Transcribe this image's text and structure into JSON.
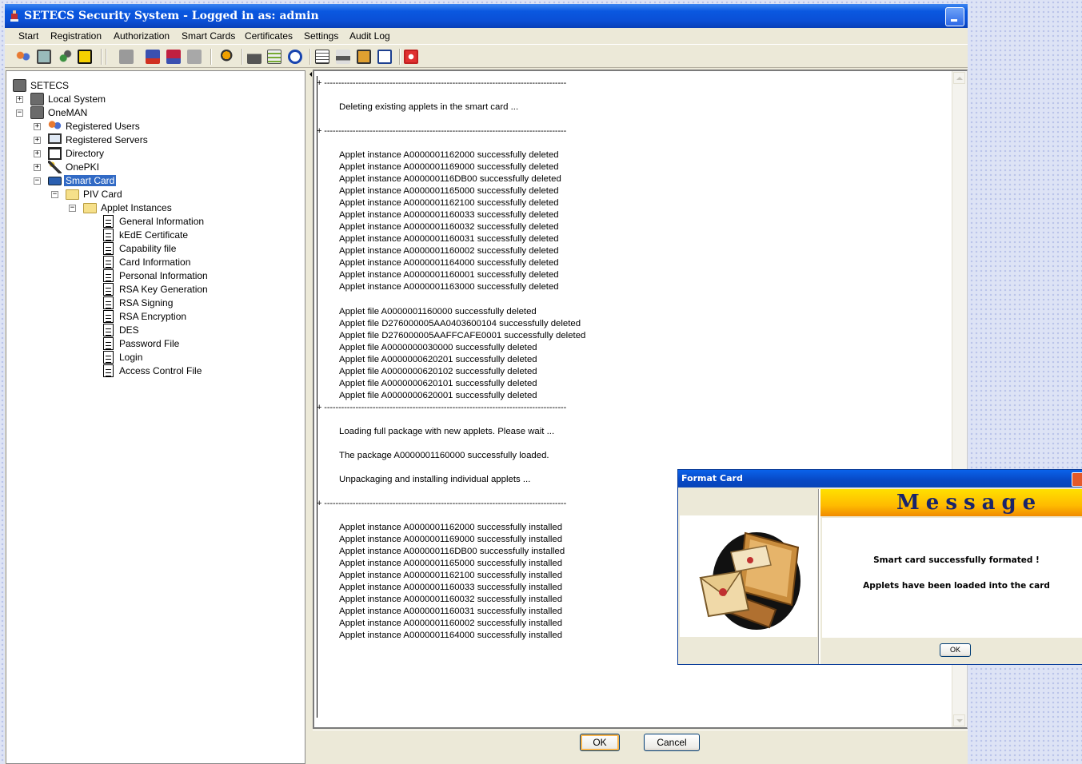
{
  "window": {
    "title": "SETECS Security System - Logged in as: admin"
  },
  "menu": [
    "Start",
    "Registration",
    "Authorization",
    "Smart Cards",
    "Certificates",
    "Settings",
    "Audit Log"
  ],
  "tree": {
    "root": "SETECS",
    "local_system": "Local System",
    "oneman": "OneMAN",
    "registered_users": "Registered Users",
    "registered_servers": "Registered Servers",
    "directory": "Directory",
    "onepki": "OnePKI",
    "smart_card": "Smart Card",
    "piv_card": "PIV Card",
    "applet_instances": "Applet Instances",
    "items": [
      "General Information",
      "kEdE Certificate",
      "Capability file",
      "Card Information",
      "Personal Information",
      "RSA Key Generation",
      "RSA Signing",
      "RSA Encryption",
      "DES",
      "Password File",
      "Login",
      "Access Control File"
    ]
  },
  "log": {
    "separator": "+ -------------------------------------------------------------------------------------",
    "deleting": "Deleting existing applets in the smart card  ...",
    "deleted_instances": [
      "Applet instance A0000001162000 successfully deleted",
      "Applet instance A0000001169000 successfully deleted",
      "Applet instance A000000116DB00 successfully deleted",
      "Applet instance A0000001165000 successfully deleted",
      "Applet instance A0000001162100 successfully deleted",
      "Applet instance A0000001160033 successfully deleted",
      "Applet instance A0000001160032 successfully deleted",
      "Applet instance A0000001160031 successfully deleted",
      "Applet instance A0000001160002 successfully deleted",
      "Applet instance A0000001164000 successfully deleted",
      "Applet instance A0000001160001 successfully deleted",
      "Applet instance A0000001163000 successfully deleted"
    ],
    "deleted_files": [
      "Applet file A0000001160000 successfully deleted",
      "Applet file D276000005AA0403600104 successfully deleted",
      "Applet file D276000005AAFFCAFE0001 successfully deleted",
      "Applet file A0000000030000 successfully deleted",
      "Applet file A0000000620201 successfully deleted",
      "Applet file A0000000620102 successfully deleted",
      "Applet file A0000000620101 successfully deleted",
      "Applet file A0000000620001 successfully deleted"
    ],
    "loading": "Loading full package with new applets. Please wait ...",
    "loaded": "The package A0000001160000 successfully loaded.",
    "unpacking": "Unpackaging and installing individual applets ...",
    "installed_instances": [
      "Applet instance A0000001162000 successfully installed",
      "Applet instance A0000001169000 successfully installed",
      "Applet instance A000000116DB00 successfully installed",
      "Applet instance A0000001165000 successfully installed",
      "Applet instance A0000001162100 successfully installed",
      "Applet instance A0000001160033 successfully installed",
      "Applet instance A0000001160032 successfully installed",
      "Applet instance A0000001160031 successfully installed",
      "Applet instance A0000001160002 successfully installed",
      "Applet instance A0000001164000 successfully installed"
    ]
  },
  "buttons": {
    "ok": "OK",
    "cancel": "Cancel"
  },
  "dialog": {
    "title": "Format Card",
    "banner": "Message",
    "line1": "Smart card successfully formated !",
    "line2": "Applets have been loaded into the card",
    "ok": "OK"
  },
  "colors": {
    "title_blue": "#0a4fd6",
    "selection": "#316ac5",
    "banner_yellow": "#ffc800",
    "banner_text": "#19246a"
  }
}
